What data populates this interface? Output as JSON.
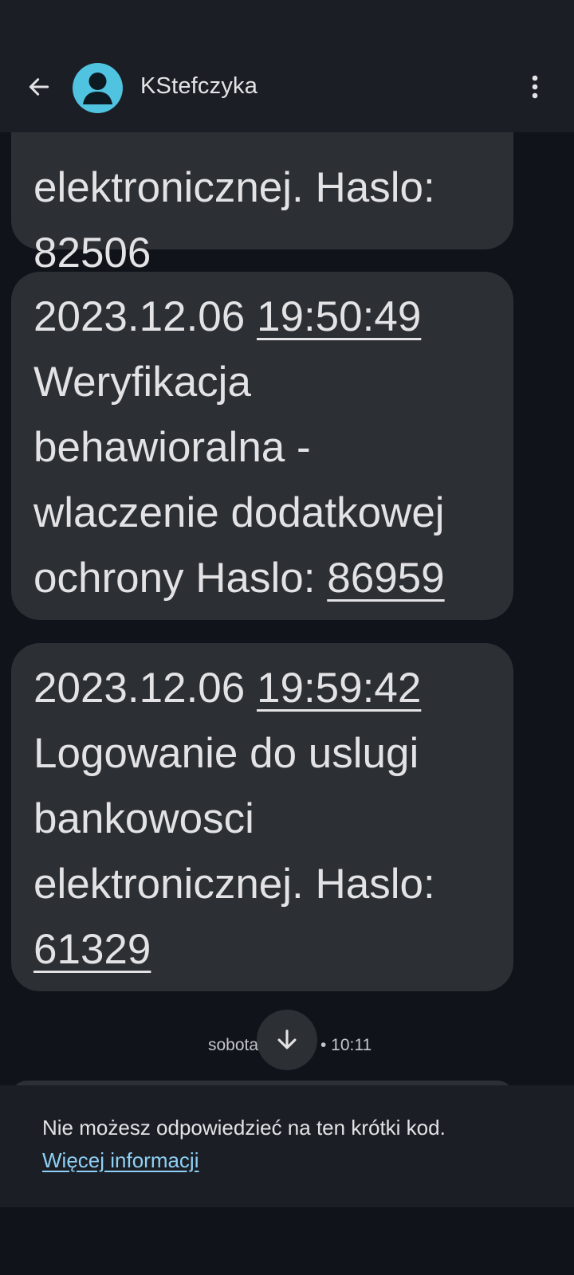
{
  "header": {
    "back_icon": "arrow-left-icon",
    "avatar_icon": "person-icon",
    "avatar_color": "#4fc3e0",
    "contact_name": "KStefczyka",
    "menu_icon": "more-vert-icon"
  },
  "messages": [
    {
      "lines": [
        "elektronicznej. Haslo:"
      ],
      "code": "82506"
    },
    {
      "date": "2023.12.06",
      "time": "19:50:49",
      "lines": [
        "Weryfikacja",
        "behawioralna -",
        "wlaczenie dodatkowej"
      ],
      "last_line_text": "ochrony Haslo:",
      "code": "86959"
    },
    {
      "date": "2023.12.06",
      "time": "19:59:42",
      "lines": [
        "Logowanie do uslugi",
        "bankowosci",
        "elektronicznej. Haslo:"
      ],
      "code": "61329"
    }
  ],
  "date_separator": {
    "day": "sobota",
    "time": "• 10:11"
  },
  "scroll_button_icon": "arrow-down-icon",
  "notice": {
    "text": "Nie możesz odpowiedzieć na ten krótki kod.",
    "link": "Więcej informacji",
    "link_color": "#8fd0f5"
  }
}
